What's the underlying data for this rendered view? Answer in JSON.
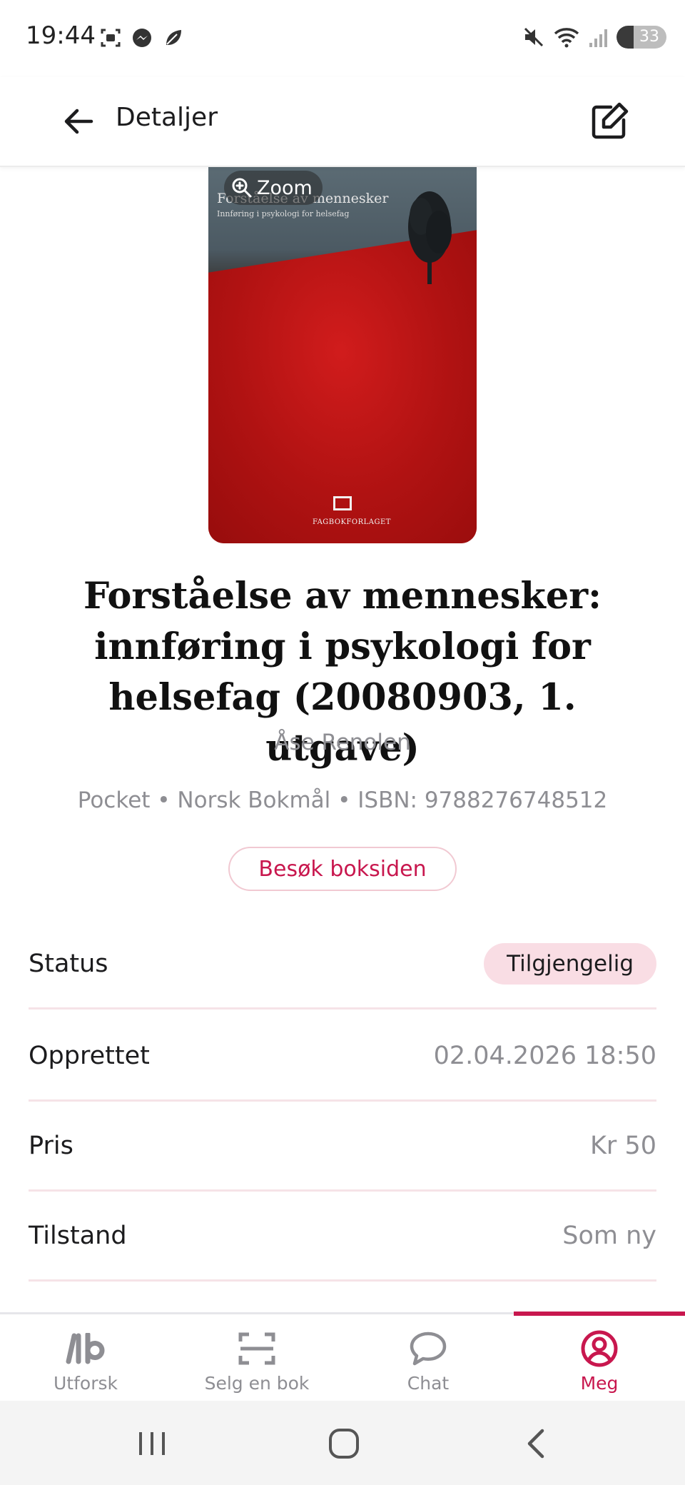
{
  "status_bar": {
    "time": "19:44",
    "battery": "33",
    "icons": [
      "screenshot-icon",
      "messenger-icon",
      "leaf-icon",
      "mute-icon",
      "wifi-icon",
      "signal-icon",
      "battery-icon"
    ]
  },
  "header": {
    "title": "Detaljer",
    "back_icon": "arrow-left-icon",
    "edit_icon": "edit-icon"
  },
  "cover": {
    "zoom_label": "Zoom",
    "zoom_icon": "zoom-in-icon",
    "cover_title": "Forståelse av mennesker",
    "cover_subtitle": "Innføring i psykologi for helsefag",
    "publisher_logo": "FAGBOKFORLAGET"
  },
  "book": {
    "title": "Forståelse av mennesker: innføring i psykologi for helsefag (20080903, 1. utgave)",
    "author": "Åse Renolen",
    "meta": "Pocket • Norsk Bokmål • ISBN: 9788276748512",
    "visit_button": "Besøk boksiden"
  },
  "details": [
    {
      "label": "Status",
      "value": "Tilgjengelig"
    },
    {
      "label": "Opprettet",
      "value": "02.04.2026 18:50"
    },
    {
      "label": "Pris",
      "value": "Kr 50"
    },
    {
      "label": "Tilstand",
      "value": "Som ny"
    }
  ],
  "bottom_nav": {
    "items": [
      {
        "label": "Utforsk",
        "icon": "explore-logo-icon"
      },
      {
        "label": "Selg en bok",
        "icon": "scan-icon"
      },
      {
        "label": "Chat",
        "icon": "chat-bubble-icon"
      },
      {
        "label": "Meg",
        "icon": "profile-icon"
      }
    ],
    "active_index": 3
  },
  "colors": {
    "accent": "#c8174e",
    "badge_bg": "#f9dde4",
    "divider": "#f6e3e7",
    "muted_text": "#8e8e93"
  }
}
